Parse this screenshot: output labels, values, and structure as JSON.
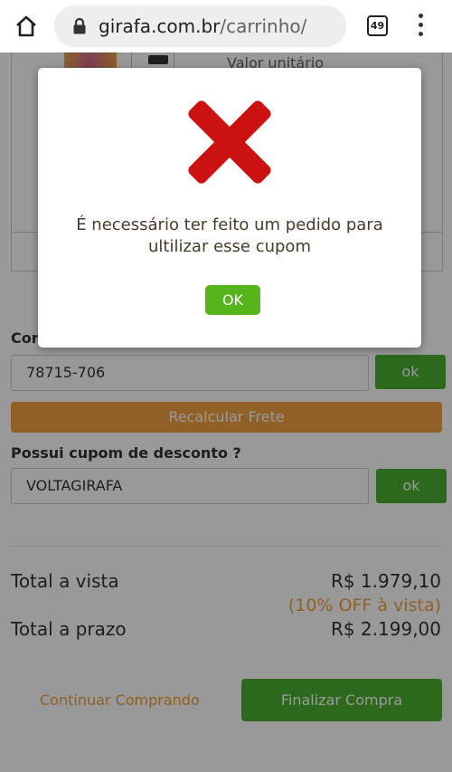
{
  "browser": {
    "url_domain": "girafa.com.br",
    "url_path": "/carrinho/",
    "tab_count": "49"
  },
  "page": {
    "unit_price_label": "Valor unitário",
    "cep": {
      "label": "Cor",
      "value": "78715-706",
      "ok_label": "ok",
      "recalc_label": "Recalcular Frete"
    },
    "coupon": {
      "label": "Possui cupom de desconto ?",
      "value": "VOLTAGIRAFA",
      "ok_label": "ok"
    },
    "totals": {
      "cash_label": "Total a vista",
      "cash_value": "R$ 1.979,10",
      "discount_note": "(10% OFF à vista)",
      "installment_label": "Total a prazo",
      "installment_value": "R$ 2.199,00"
    },
    "continue_label": "Continuar Comprando",
    "finalize_label": "Finalizar Compra"
  },
  "modal": {
    "message": "É necessário ter feito um pedido para ultilizar esse cupom",
    "glyph": "",
    "ok_label": "OK",
    "icon": "error-x-icon",
    "icon_color": "#cc1111"
  },
  "colors": {
    "green": "#4caf30",
    "orange": "#f0a040"
  }
}
